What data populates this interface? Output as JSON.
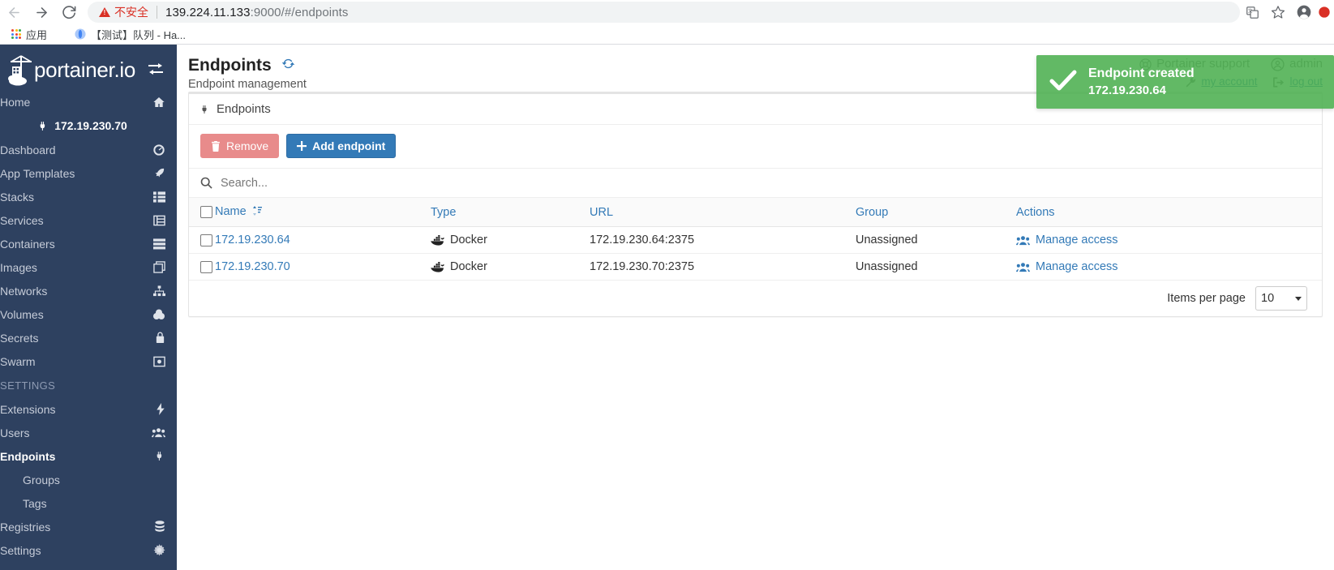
{
  "browser": {
    "security_label": "不安全",
    "url_host": "139.224.11.133",
    "url_rest": ":9000/#/endpoints",
    "bookmarks": [
      {
        "label": "应用",
        "icon": "apps-grid-icon"
      },
      {
        "label": "【测试】队列 - Ha...",
        "icon": "globe-icon"
      }
    ],
    "toolbar_icons": [
      "translate-icon",
      "star-icon",
      "profile-avatar-icon"
    ]
  },
  "sidebar": {
    "brand": "portainer.io",
    "toggle_icon": "collapse-sidebar-icon",
    "items": [
      {
        "label": "Home",
        "icon": "home-icon",
        "type": "link",
        "active": false
      },
      {
        "label": "172.19.230.70",
        "icon": "plug-icon",
        "type": "endpoint-chip",
        "active": false
      },
      {
        "label": "Dashboard",
        "icon": "dashboard-icon",
        "type": "link",
        "active": false
      },
      {
        "label": "App Templates",
        "icon": "rocket-icon",
        "type": "link",
        "active": false
      },
      {
        "label": "Stacks",
        "icon": "stacks-icon",
        "type": "link",
        "active": false
      },
      {
        "label": "Services",
        "icon": "services-icon",
        "type": "link",
        "active": false
      },
      {
        "label": "Containers",
        "icon": "containers-icon",
        "type": "link",
        "active": false
      },
      {
        "label": "Images",
        "icon": "images-icon",
        "type": "link",
        "active": false
      },
      {
        "label": "Networks",
        "icon": "networks-icon",
        "type": "link",
        "active": false
      },
      {
        "label": "Volumes",
        "icon": "volumes-icon",
        "type": "link",
        "active": false
      },
      {
        "label": "Secrets",
        "icon": "secrets-icon",
        "type": "link",
        "active": false
      },
      {
        "label": "Swarm",
        "icon": "swarm-icon",
        "type": "link",
        "active": false
      },
      {
        "label": "SETTINGS",
        "icon": "",
        "type": "section",
        "active": false
      },
      {
        "label": "Extensions",
        "icon": "bolt-icon",
        "type": "link",
        "active": false
      },
      {
        "label": "Users",
        "icon": "users-icon",
        "type": "link",
        "active": false
      },
      {
        "label": "Endpoints",
        "icon": "plug-icon",
        "type": "link",
        "active": true
      },
      {
        "label": "Groups",
        "icon": "",
        "type": "sublink",
        "active": false
      },
      {
        "label": "Tags",
        "icon": "",
        "type": "sublink",
        "active": false
      },
      {
        "label": "Registries",
        "icon": "registries-icon",
        "type": "link",
        "active": false
      },
      {
        "label": "Settings",
        "icon": "settings-icon",
        "type": "link",
        "active": false
      }
    ]
  },
  "header": {
    "title": "Endpoints",
    "refresh_icon": "refresh-icon",
    "subtitle": "Endpoint management",
    "support_label": "Portainer support",
    "support_icon": "lifebuoy-icon",
    "user_label": "admin",
    "user_icon": "user-circle-icon",
    "my_account_label": "my account",
    "my_account_icon": "wrench-icon",
    "logout_label": "log out",
    "logout_icon": "signout-icon"
  },
  "card": {
    "title": "Endpoints",
    "title_icon": "plug-icon",
    "remove_label": "Remove",
    "remove_icon": "trash-icon",
    "add_label": "Add endpoint",
    "add_icon": "plus-icon",
    "remove_color": "#e88b8b",
    "add_color": "#337ab7"
  },
  "search": {
    "icon": "search-icon",
    "placeholder": "Search...",
    "value": ""
  },
  "table": {
    "columns": [
      {
        "key": "checkbox",
        "label": ""
      },
      {
        "key": "name",
        "label": "Name",
        "sortable": true,
        "sort_icon": "sort-icon"
      },
      {
        "key": "type",
        "label": "Type",
        "sortable": true
      },
      {
        "key": "url",
        "label": "URL",
        "sortable": true
      },
      {
        "key": "group",
        "label": "Group",
        "sortable": true
      },
      {
        "key": "actions",
        "label": "Actions",
        "sortable": false
      }
    ],
    "rows": [
      {
        "checked": false,
        "name": "172.19.230.64",
        "type": "Docker",
        "type_icon": "docker-icon",
        "url": "172.19.230.64:2375",
        "group": "Unassigned",
        "action_label": "Manage access",
        "action_icon": "manage-access-icon"
      },
      {
        "checked": false,
        "name": "172.19.230.70",
        "type": "Docker",
        "type_icon": "docker-icon",
        "url": "172.19.230.70:2375",
        "group": "Unassigned",
        "action_label": "Manage access",
        "action_icon": "manage-access-icon"
      }
    ],
    "footer": {
      "items_per_page_label": "Items per page",
      "items_per_page_value": "10"
    }
  },
  "toast": {
    "icon": "check-icon",
    "title": "Endpoint created",
    "subtitle": "172.19.230.64",
    "color": "#4caf50"
  }
}
